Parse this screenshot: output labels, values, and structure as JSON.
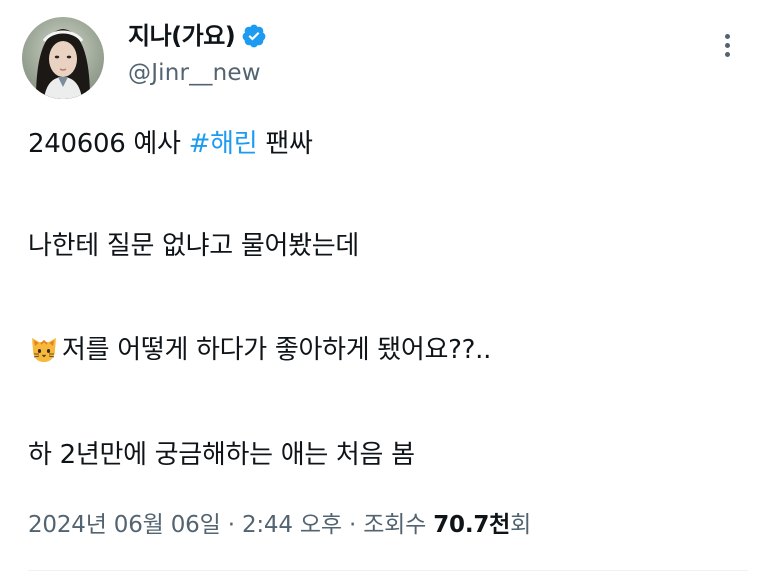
{
  "author": {
    "display_name": "지나(가요)",
    "handle": "@Jinr__new",
    "verified": true
  },
  "tweet": {
    "line1_prefix": "240606 예사 ",
    "hashtag": "#해린",
    "line1_suffix": " 팬싸",
    "line2": "나한테 질문 없냐고 물어봤는데",
    "line3_emoji": "cat-face-emoji",
    "line3": "저를 어떻게 하다가 좋아하게 됐어요??..",
    "line4": "하 2년만에 궁금해하는 애는 처음 봄"
  },
  "meta": {
    "date": "2024년 06월 06일",
    "separator": "·",
    "time": "2:44 오후",
    "views_label": "조회수",
    "views_count": "70.7천",
    "views_suffix": "회"
  },
  "icons": {
    "verified": "verified-badge-icon",
    "more": "more-options-icon"
  },
  "colors": {
    "accent": "#1d9bf0",
    "text": "#0f1419",
    "secondary": "#536471"
  }
}
